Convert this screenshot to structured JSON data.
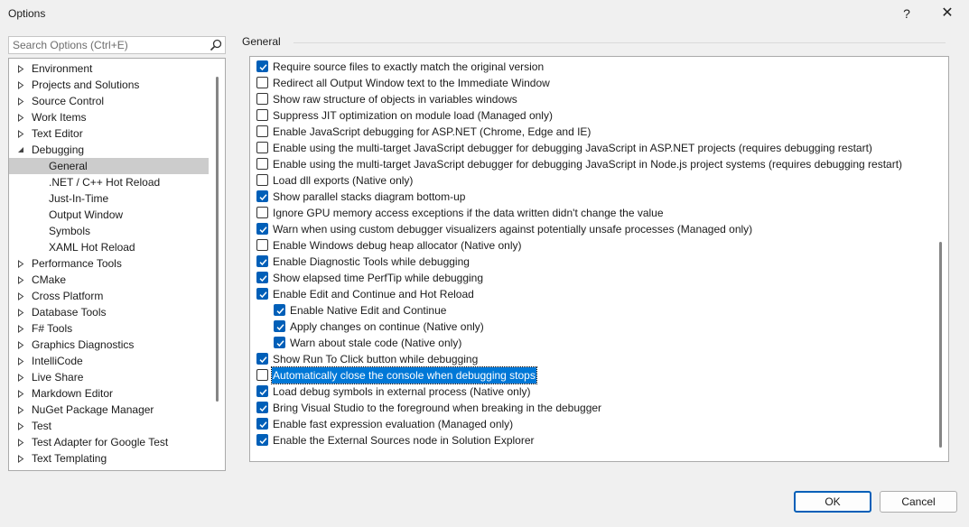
{
  "window": {
    "title": "Options",
    "help_glyph": "?",
    "close_glyph": "✕"
  },
  "search": {
    "placeholder": "Search Options (Ctrl+E)"
  },
  "tree": [
    {
      "label": "Environment",
      "expandable": true,
      "expanded": false,
      "level": 0
    },
    {
      "label": "Projects and Solutions",
      "expandable": true,
      "expanded": false,
      "level": 0
    },
    {
      "label": "Source Control",
      "expandable": true,
      "expanded": false,
      "level": 0
    },
    {
      "label": "Work Items",
      "expandable": true,
      "expanded": false,
      "level": 0
    },
    {
      "label": "Text Editor",
      "expandable": true,
      "expanded": false,
      "level": 0
    },
    {
      "label": "Debugging",
      "expandable": true,
      "expanded": true,
      "level": 0
    },
    {
      "label": "General",
      "expandable": false,
      "level": 1,
      "selected": true
    },
    {
      "label": ".NET / C++ Hot Reload",
      "expandable": false,
      "level": 1
    },
    {
      "label": "Just-In-Time",
      "expandable": false,
      "level": 1
    },
    {
      "label": "Output Window",
      "expandable": false,
      "level": 1
    },
    {
      "label": "Symbols",
      "expandable": false,
      "level": 1
    },
    {
      "label": "XAML Hot Reload",
      "expandable": false,
      "level": 1
    },
    {
      "label": "Performance Tools",
      "expandable": true,
      "expanded": false,
      "level": 0
    },
    {
      "label": "CMake",
      "expandable": true,
      "expanded": false,
      "level": 0
    },
    {
      "label": "Cross Platform",
      "expandable": true,
      "expanded": false,
      "level": 0
    },
    {
      "label": "Database Tools",
      "expandable": true,
      "expanded": false,
      "level": 0
    },
    {
      "label": "F# Tools",
      "expandable": true,
      "expanded": false,
      "level": 0
    },
    {
      "label": "Graphics Diagnostics",
      "expandable": true,
      "expanded": false,
      "level": 0
    },
    {
      "label": "IntelliCode",
      "expandable": true,
      "expanded": false,
      "level": 0
    },
    {
      "label": "Live Share",
      "expandable": true,
      "expanded": false,
      "level": 0
    },
    {
      "label": "Markdown Editor",
      "expandable": true,
      "expanded": false,
      "level": 0
    },
    {
      "label": "NuGet Package Manager",
      "expandable": true,
      "expanded": false,
      "level": 0
    },
    {
      "label": "Test",
      "expandable": true,
      "expanded": false,
      "level": 0
    },
    {
      "label": "Test Adapter for Google Test",
      "expandable": true,
      "expanded": false,
      "level": 0
    },
    {
      "label": "Text Templating",
      "expandable": true,
      "expanded": false,
      "level": 0
    }
  ],
  "section_title": "General",
  "options": [
    {
      "label": "Require source files to exactly match the original version",
      "checked": true,
      "level": 0
    },
    {
      "label": "Redirect all Output Window text to the Immediate Window",
      "checked": false,
      "level": 0
    },
    {
      "label": "Show raw structure of objects in variables windows",
      "checked": false,
      "level": 0
    },
    {
      "label": "Suppress JIT optimization on module load (Managed only)",
      "checked": false,
      "level": 0
    },
    {
      "label": "Enable JavaScript debugging for ASP.NET (Chrome, Edge and IE)",
      "checked": false,
      "level": 0
    },
    {
      "label": "Enable using the multi-target JavaScript debugger for debugging JavaScript in ASP.NET projects (requires debugging restart)",
      "checked": false,
      "level": 0
    },
    {
      "label": "Enable using the multi-target JavaScript debugger for debugging JavaScript in Node.js project systems (requires debugging restart)",
      "checked": false,
      "level": 0
    },
    {
      "label": "Load dll exports (Native only)",
      "checked": false,
      "level": 0
    },
    {
      "label": "Show parallel stacks diagram bottom-up",
      "checked": true,
      "level": 0
    },
    {
      "label": "Ignore GPU memory access exceptions if the data written didn't change the value",
      "checked": false,
      "level": 0
    },
    {
      "label": "Warn when using custom debugger visualizers against potentially unsafe processes (Managed only)",
      "checked": true,
      "level": 0
    },
    {
      "label": "Enable Windows debug heap allocator (Native only)",
      "checked": false,
      "level": 0
    },
    {
      "label": "Enable Diagnostic Tools while debugging",
      "checked": true,
      "level": 0
    },
    {
      "label": "Show elapsed time PerfTip while debugging",
      "checked": true,
      "level": 0
    },
    {
      "label": "Enable Edit and Continue and Hot Reload",
      "checked": true,
      "level": 0
    },
    {
      "label": "Enable Native Edit and Continue",
      "checked": true,
      "level": 1
    },
    {
      "label": "Apply changes on continue (Native only)",
      "checked": true,
      "level": 1
    },
    {
      "label": "Warn about stale code (Native only)",
      "checked": true,
      "level": 1
    },
    {
      "label": "Show Run To Click button while debugging",
      "checked": true,
      "level": 0
    },
    {
      "label": "Automatically close the console when debugging stops",
      "checked": false,
      "level": 0,
      "focused": true
    },
    {
      "label": "Load debug symbols in external process (Native only)",
      "checked": true,
      "level": 0
    },
    {
      "label": "Bring Visual Studio to the foreground when breaking in the debugger",
      "checked": true,
      "level": 0
    },
    {
      "label": "Enable fast expression evaluation (Managed only)",
      "checked": true,
      "level": 0
    },
    {
      "label": "Enable the External Sources node in Solution Explorer",
      "checked": true,
      "level": 0
    }
  ],
  "buttons": {
    "ok": "OK",
    "cancel": "Cancel"
  }
}
